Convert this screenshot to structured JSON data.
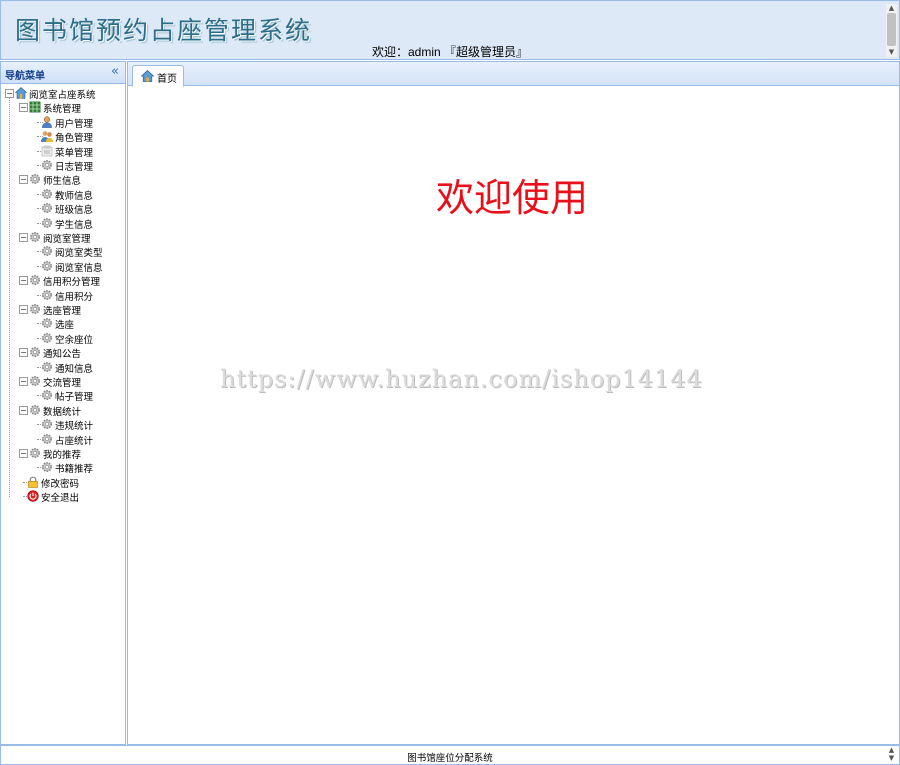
{
  "header": {
    "app_title": "图书馆预约占座管理系统",
    "welcome": "欢迎：admin 『超级管理员』"
  },
  "sidebar": {
    "title": "导航菜单",
    "collapse_icon": "double-chevron-left-icon",
    "root": {
      "label": "阅览室占座系统",
      "icon": "home-icon"
    },
    "groups": [
      {
        "label": "系统管理",
        "icon": "grid-icon",
        "items": [
          {
            "label": "用户管理",
            "icon": "user-icon"
          },
          {
            "label": "角色管理",
            "icon": "users-icon"
          },
          {
            "label": "菜单管理",
            "icon": "menu-icon"
          },
          {
            "label": "日志管理",
            "icon": "gear-icon"
          }
        ]
      },
      {
        "label": "师生信息",
        "icon": "gear-icon",
        "items": [
          {
            "label": "教师信息",
            "icon": "gear-icon"
          },
          {
            "label": "班级信息",
            "icon": "gear-icon"
          },
          {
            "label": "学生信息",
            "icon": "gear-icon"
          }
        ]
      },
      {
        "label": "阅览室管理",
        "icon": "gear-icon",
        "items": [
          {
            "label": "阅览室类型",
            "icon": "gear-icon"
          },
          {
            "label": "阅览室信息",
            "icon": "gear-icon"
          }
        ]
      },
      {
        "label": "信用积分管理",
        "icon": "gear-icon",
        "items": [
          {
            "label": "信用积分",
            "icon": "gear-icon"
          }
        ]
      },
      {
        "label": "选座管理",
        "icon": "gear-icon",
        "items": [
          {
            "label": "选座",
            "icon": "gear-icon"
          },
          {
            "label": "空余座位",
            "icon": "gear-icon"
          }
        ]
      },
      {
        "label": "通知公告",
        "icon": "gear-icon",
        "items": [
          {
            "label": "通知信息",
            "icon": "gear-icon"
          }
        ]
      },
      {
        "label": "交流管理",
        "icon": "gear-icon",
        "items": [
          {
            "label": "帖子管理",
            "icon": "gear-icon"
          }
        ]
      },
      {
        "label": "数据统计",
        "icon": "gear-icon",
        "items": [
          {
            "label": "违规统计",
            "icon": "gear-icon"
          },
          {
            "label": "占座统计",
            "icon": "gear-icon"
          }
        ]
      },
      {
        "label": "我的推荐",
        "icon": "gear-icon",
        "items": [
          {
            "label": "书籍推荐",
            "icon": "gear-icon"
          }
        ]
      }
    ],
    "bottom_items": [
      {
        "label": "修改密码",
        "icon": "lock-icon"
      },
      {
        "label": "安全退出",
        "icon": "exit-icon"
      }
    ]
  },
  "main": {
    "tabs": [
      {
        "label": "首页",
        "icon": "home-icon",
        "active": true
      }
    ],
    "welcome_heading": "欢迎使用",
    "watermark": "https://www.huzhan.com/ishop14144"
  },
  "footer": {
    "text": "图书馆座位分配系统"
  },
  "colors": {
    "border": "#99bbe8",
    "header_bg": "#dde9f7",
    "heading_red": "#e8101a",
    "title_teal": "#2c6e8a"
  }
}
